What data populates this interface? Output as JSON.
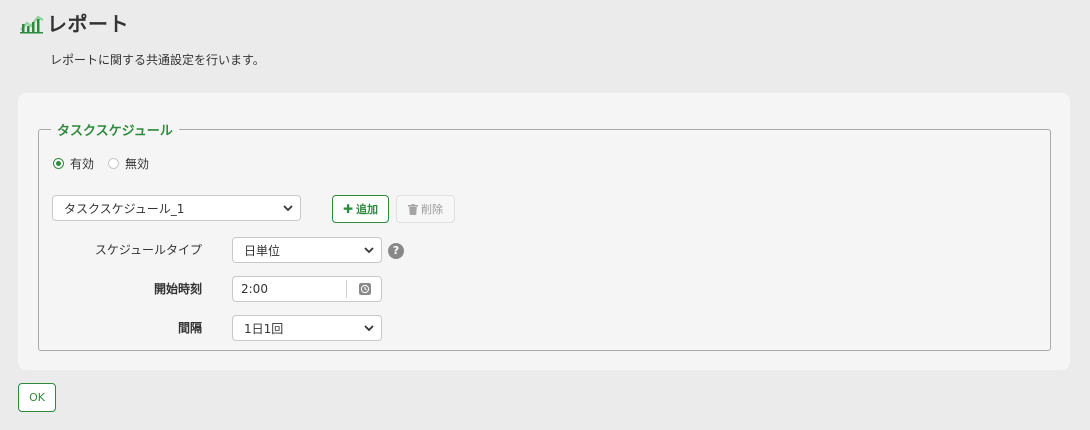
{
  "header": {
    "title": "レポート",
    "icon": "chart-icon"
  },
  "description": "レポートに関する共通設定を行います。",
  "task_schedule": {
    "legend": "タスクスケジュール",
    "radio_options": [
      {
        "label": "有効",
        "checked": true
      },
      {
        "label": "無効",
        "checked": false
      }
    ],
    "selected_schedule": "タスクスケジュール_1",
    "add_label": "追加",
    "delete_label": "削除",
    "type_label": "スケジュールタイプ",
    "type_value": "日単位",
    "help_symbol": "?",
    "start_label": "開始時刻",
    "start_value": "2:00",
    "interval_label": "間隔",
    "interval_value": "1日1回"
  },
  "ok_label": "OK",
  "colors": {
    "accent": "#2e8b3d",
    "background": "#ebebeb",
    "panel": "#f5f5f5"
  }
}
